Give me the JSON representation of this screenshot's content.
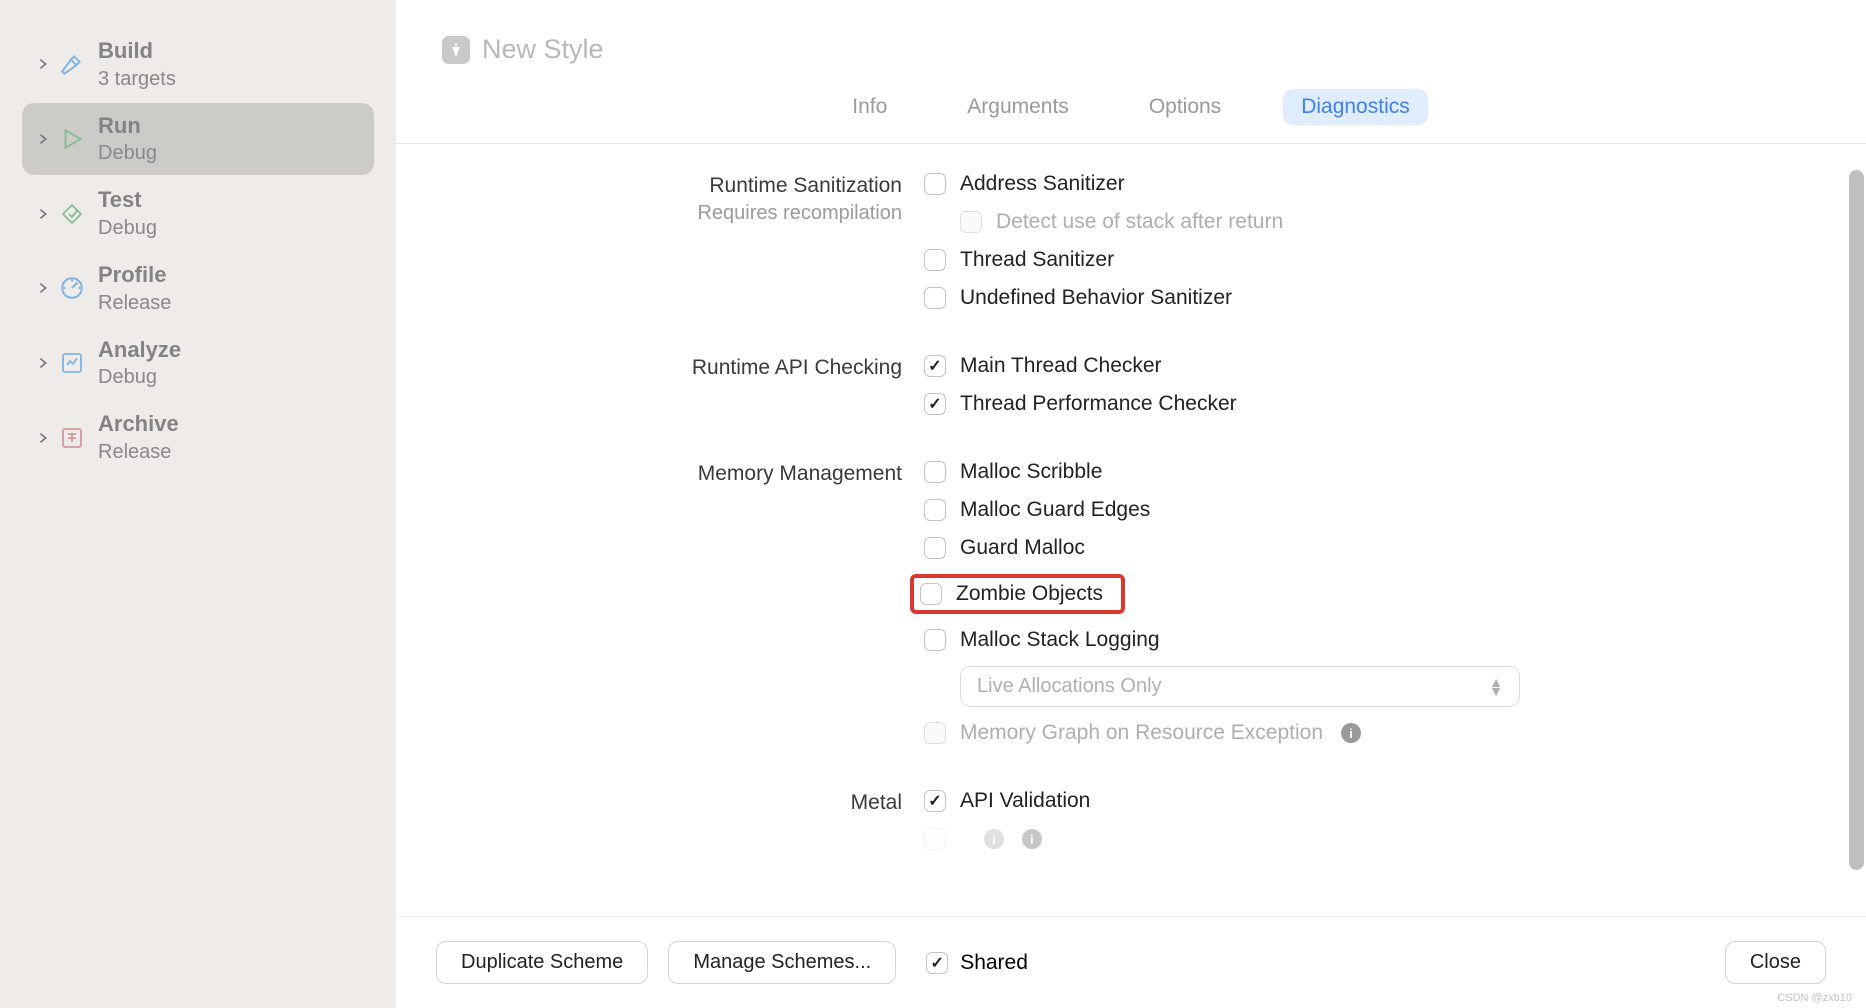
{
  "header": {
    "title": "New Style"
  },
  "sidebar": [
    {
      "title": "Build",
      "sub": "3 targets",
      "icon": "hammer"
    },
    {
      "title": "Run",
      "sub": "Debug",
      "icon": "play",
      "selected": true
    },
    {
      "title": "Test",
      "sub": "Debug",
      "icon": "diamond"
    },
    {
      "title": "Profile",
      "sub": "Release",
      "icon": "gauge"
    },
    {
      "title": "Analyze",
      "sub": "Debug",
      "icon": "analyze"
    },
    {
      "title": "Archive",
      "sub": "Release",
      "icon": "archive"
    }
  ],
  "tabs": [
    {
      "label": "Info"
    },
    {
      "label": "Arguments"
    },
    {
      "label": "Options"
    },
    {
      "label": "Diagnostics",
      "active": true
    }
  ],
  "sections": {
    "runtime_sanitization": {
      "label": "Runtime Sanitization",
      "sublabel": "Requires recompilation",
      "options": [
        {
          "label": "Address Sanitizer",
          "checked": false
        },
        {
          "label": "Detect use of stack after return",
          "checked": false,
          "disabled": true,
          "sub": true
        },
        {
          "label": "Thread Sanitizer",
          "checked": false
        },
        {
          "label": "Undefined Behavior Sanitizer",
          "checked": false
        }
      ]
    },
    "runtime_api_checking": {
      "label": "Runtime API Checking",
      "options": [
        {
          "label": "Main Thread Checker",
          "checked": true
        },
        {
          "label": "Thread Performance Checker",
          "checked": true
        }
      ]
    },
    "memory_management": {
      "label": "Memory Management",
      "options": [
        {
          "label": "Malloc Scribble",
          "checked": false
        },
        {
          "label": "Malloc Guard Edges",
          "checked": false
        },
        {
          "label": "Guard Malloc",
          "checked": false
        },
        {
          "label": "Zombie Objects",
          "checked": false,
          "highlight": true
        },
        {
          "label": "Malloc Stack Logging",
          "checked": false
        }
      ],
      "select": {
        "value": "Live Allocations Only"
      },
      "memory_graph": {
        "label": "Memory Graph on Resource Exception",
        "checked": false,
        "disabled": true
      }
    },
    "metal": {
      "label": "Metal",
      "options": [
        {
          "label": "API Validation",
          "checked": true
        }
      ]
    }
  },
  "footer": {
    "duplicate": "Duplicate Scheme",
    "manage": "Manage Schemes...",
    "shared_label": "Shared",
    "shared_checked": true,
    "close": "Close"
  },
  "watermark": "CSDN @zxb10"
}
